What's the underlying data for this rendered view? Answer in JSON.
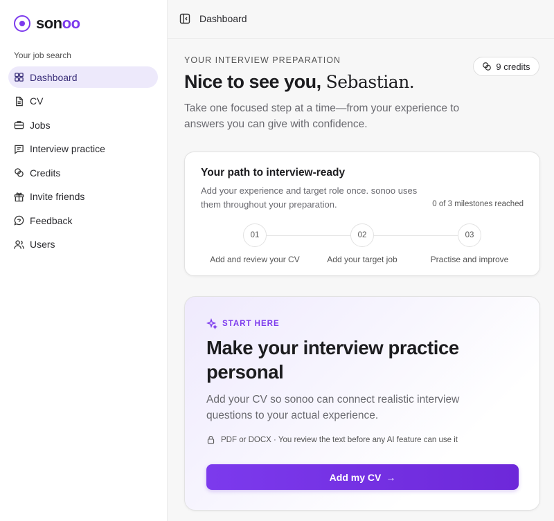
{
  "brand": {
    "name_prefix": "son",
    "name_accent": "oo"
  },
  "sidebar": {
    "section_label": "Your job search",
    "items": [
      {
        "label": "Dashboard",
        "icon": "grid-icon",
        "active": true
      },
      {
        "label": "CV",
        "icon": "document-icon"
      },
      {
        "label": "Jobs",
        "icon": "briefcase-icon"
      },
      {
        "label": "Interview practice",
        "icon": "chat-icon"
      },
      {
        "label": "Credits",
        "icon": "coins-icon"
      },
      {
        "label": "Invite friends",
        "icon": "gift-icon"
      },
      {
        "label": "Feedback",
        "icon": "message-icon"
      },
      {
        "label": "Users",
        "icon": "users-icon"
      }
    ]
  },
  "topbar": {
    "title": "Dashboard"
  },
  "header": {
    "eyebrow": "YOUR INTERVIEW PREPARATION",
    "greeting": "Nice to see you,",
    "name": "Sebastian.",
    "intro": "Take one focused step at a time—from your experience to answers you can give with confidence.",
    "credits": "9 credits"
  },
  "path": {
    "title": "Your path to interview-ready",
    "description": "Add your experience and target role once. sonoo uses them throughout your preparation.",
    "milestones": "0 of 3 milestones reached",
    "steps": [
      {
        "number": "01",
        "label": "Add and review your CV"
      },
      {
        "number": "02",
        "label": "Add your target job"
      },
      {
        "number": "03",
        "label": "Practise and improve"
      }
    ]
  },
  "start": {
    "eyebrow": "START HERE",
    "title": "Make your interview practice personal",
    "description": "Add your CV so sonoo can connect realistic interview questions to your actual experience.",
    "note": "PDF or DOCX · You review the text before any AI feature can use it",
    "cta": "Add my CV",
    "cta_arrow": "→"
  },
  "colors": {
    "accent": "#7c3aed",
    "active_nav_bg": "#ede9fb"
  }
}
